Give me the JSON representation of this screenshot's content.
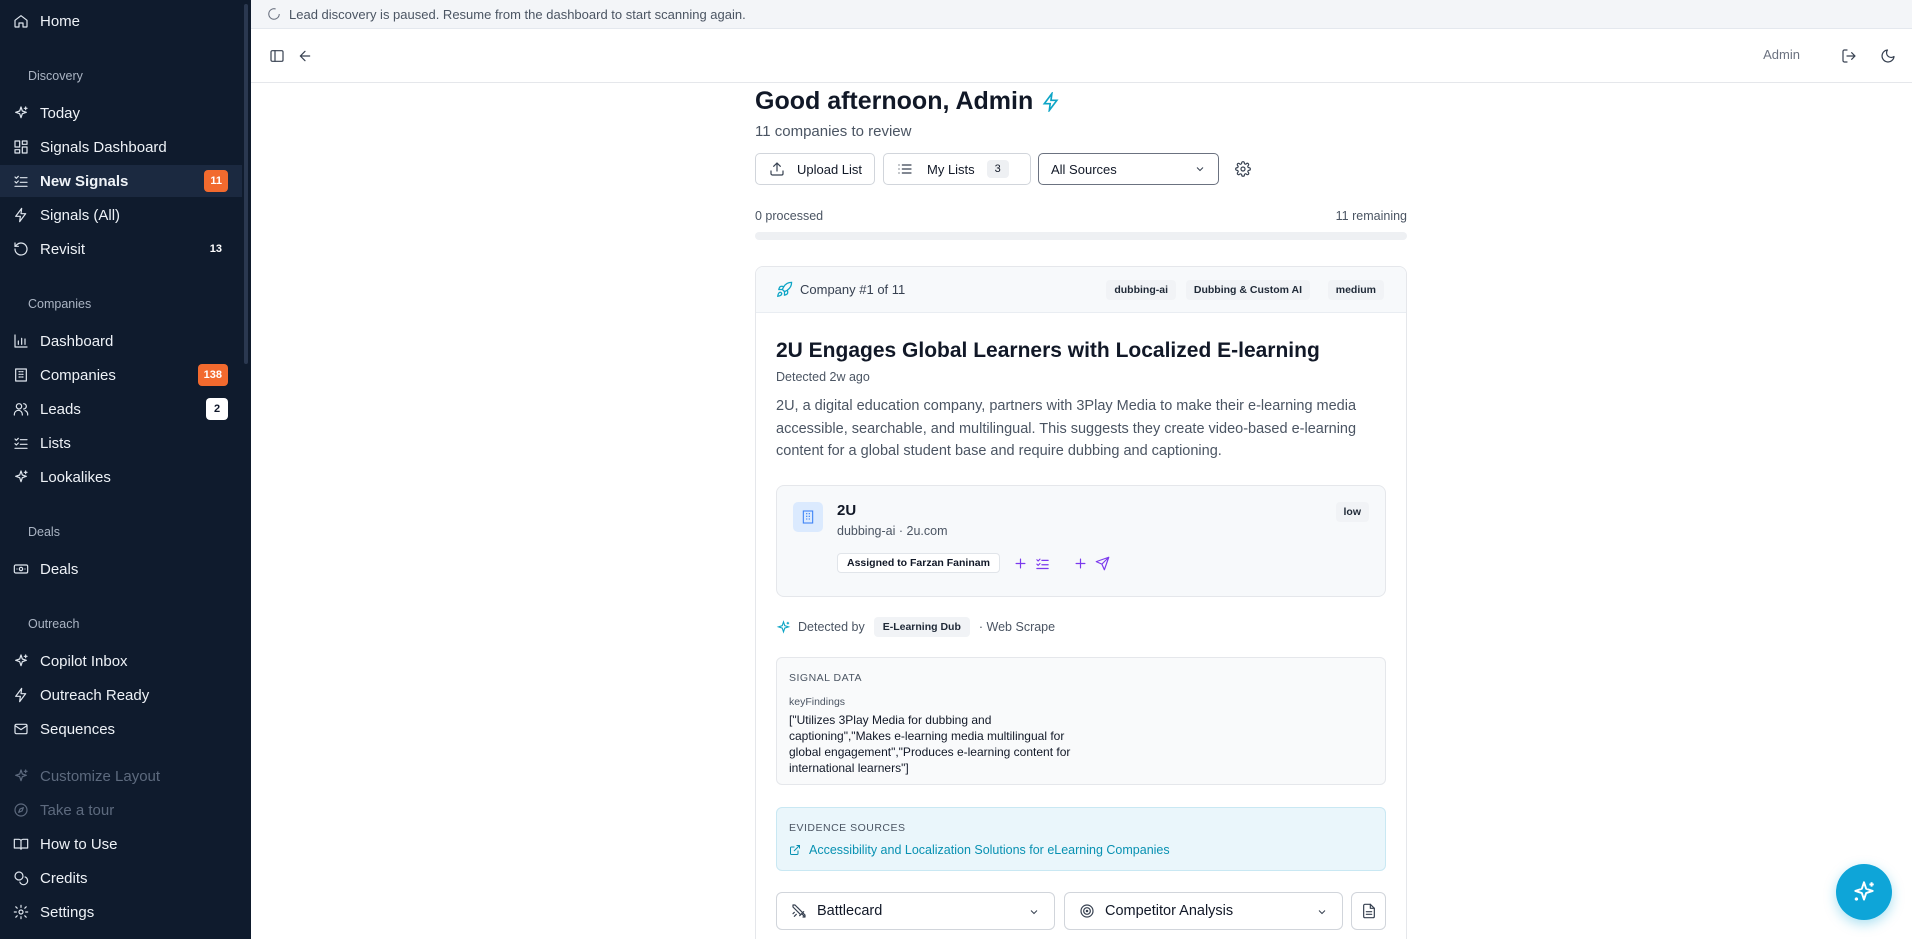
{
  "sidebar": {
    "home": "Home",
    "sections": {
      "discovery": "Discovery",
      "companies": "Companies",
      "deals": "Deals",
      "outreach": "Outreach"
    },
    "discovery_items": [
      {
        "label": "Today"
      },
      {
        "label": "Signals Dashboard"
      },
      {
        "label": "New Signals",
        "badge": "11"
      },
      {
        "label": "Signals (All)"
      },
      {
        "label": "Revisit",
        "badge": "13"
      }
    ],
    "companies_items": [
      {
        "label": "Dashboard"
      },
      {
        "label": "Companies",
        "badge": "138"
      },
      {
        "label": "Leads",
        "badge": "2"
      },
      {
        "label": "Lists"
      },
      {
        "label": "Lookalikes"
      }
    ],
    "deals_items": [
      {
        "label": "Deals"
      }
    ],
    "outreach_items": [
      {
        "label": "Copilot Inbox"
      },
      {
        "label": "Outreach Ready"
      },
      {
        "label": "Sequences"
      }
    ],
    "footer_items": [
      {
        "label": "Customize Layout"
      },
      {
        "label": "Take a tour"
      },
      {
        "label": "How to Use"
      },
      {
        "label": "Credits"
      },
      {
        "label": "Settings"
      }
    ]
  },
  "banner": {
    "text": "Lead discovery is paused. Resume from the dashboard to start scanning again."
  },
  "header": {
    "user": "Admin"
  },
  "main": {
    "greeting": "Good afternoon, Admin",
    "subtitle": "11 companies to review",
    "upload_label": "Upload List",
    "my_lists_label": "My Lists",
    "my_lists_count": "3",
    "source_select": "All Sources",
    "processed": "0 processed",
    "remaining": "11 remaining"
  },
  "card": {
    "position_label": "Company #1 of 11",
    "tags": [
      "dubbing-ai",
      "Dubbing & Custom AI",
      "medium"
    ],
    "title": "2U Engages Global Learners with Localized E-learning",
    "detected": "Detected 2w ago",
    "description": "2U, a digital education company, partners with 3Play Media to make their e-learning media accessible, searchable, and multilingual. This suggests they create video-based e-learning content for a global student base and require dubbing and captioning.",
    "company": {
      "name": "2U",
      "meta": "dubbing-ai · 2u.com",
      "priority": "low",
      "assigned": "Assigned to Farzan Faninam"
    },
    "detected_by_label": "Detected by",
    "detected_by_tag": "E-Learning Dub",
    "detected_by_source": "· Web Scrape",
    "signal_data": {
      "title": "SIGNAL DATA",
      "key": "keyFindings",
      "value": "[\"Utilizes 3Play Media for dubbing and captioning\",\"Makes e-learning media multilingual for global engagement\",\"Produces e-learning content for international learners\"]"
    },
    "evidence": {
      "title": "EVIDENCE SOURCES",
      "link": "Accessibility and Localization Solutions for eLearning Companies"
    },
    "dropdowns": {
      "battlecard": "Battlecard",
      "competitor": "Competitor Analysis"
    }
  },
  "colors": {
    "sidebar_bg": "#0f1b2d",
    "accent": "#0ea5d8",
    "badge_orange": "#f26a2e",
    "action_purple": "#7c3aed"
  }
}
